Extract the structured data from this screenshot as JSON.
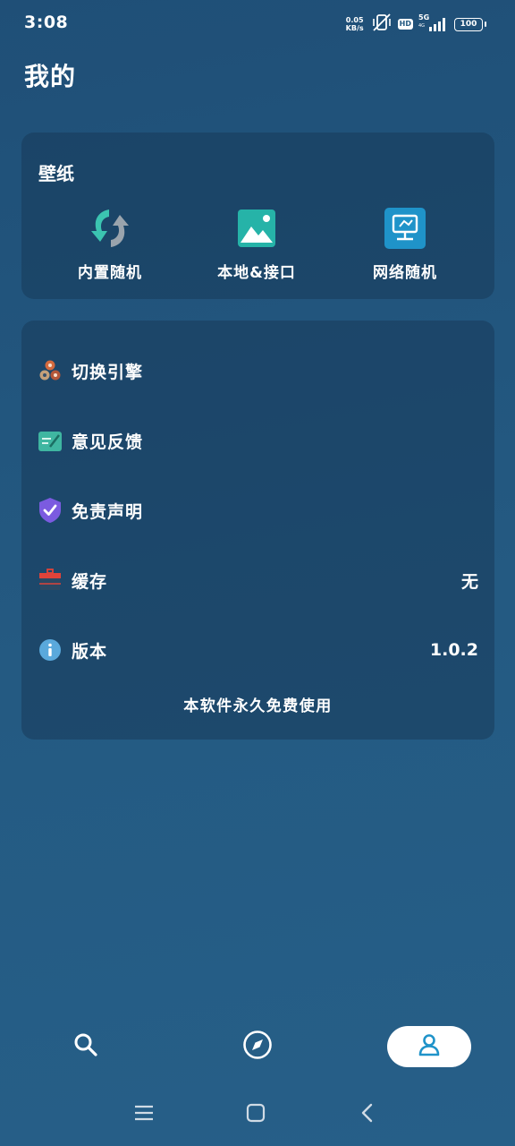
{
  "status_bar": {
    "time": "3:08",
    "net_speed_value": "0.05",
    "net_speed_unit": "KB/s",
    "hd": "HD",
    "network": "5G",
    "network_sub": "4G",
    "battery": "100"
  },
  "page": {
    "title": "我的"
  },
  "wallpaper": {
    "title": "壁纸",
    "items": [
      {
        "label": "内置随机",
        "icon": "refresh-arrows-icon"
      },
      {
        "label": "本地&接口",
        "icon": "image-icon"
      },
      {
        "label": "网络随机",
        "icon": "network-monitor-icon"
      }
    ]
  },
  "settings": {
    "items": [
      {
        "label": "切换引擎",
        "icon": "engine-switch-icon",
        "value": ""
      },
      {
        "label": "意见反馈",
        "icon": "feedback-icon",
        "value": ""
      },
      {
        "label": "免责声明",
        "icon": "shield-check-icon",
        "value": ""
      },
      {
        "label": "缓存",
        "icon": "cache-icon",
        "value": "无"
      },
      {
        "label": "版本",
        "icon": "info-icon",
        "value": "1.0.2"
      }
    ],
    "footer_note": "本软件永久免费使用"
  },
  "bottom_nav": {
    "items": [
      {
        "name": "search",
        "icon": "search-icon",
        "active": false
      },
      {
        "name": "discover",
        "icon": "compass-icon",
        "active": false
      },
      {
        "name": "profile",
        "icon": "person-icon",
        "active": true
      }
    ]
  },
  "colors": {
    "background": "#245a82",
    "card": "#1e4668",
    "accent": "#1f93c9",
    "active_nav_bg": "#ffffff"
  }
}
